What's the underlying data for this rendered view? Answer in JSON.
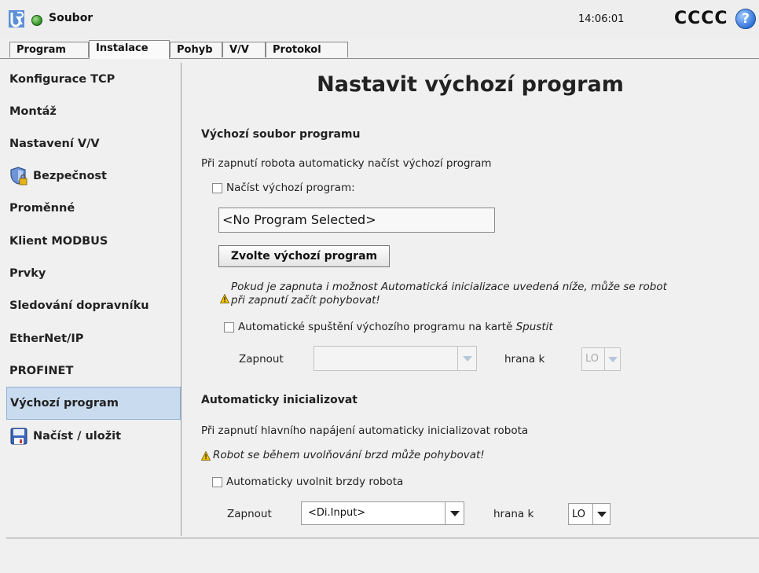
{
  "header": {
    "app_name": "Soubor",
    "clock": "14:06:01",
    "robot_name": "CCCC",
    "help_label": "?"
  },
  "tabs": [
    {
      "label": "Program"
    },
    {
      "label": "Instalace"
    },
    {
      "label": "Pohyb"
    },
    {
      "label": "V/V"
    },
    {
      "label": "Protokol"
    }
  ],
  "sidebar": {
    "items": [
      {
        "label": "Konfigurace TCP"
      },
      {
        "label": "Montáž"
      },
      {
        "label": "Nastavení V/V"
      },
      {
        "label": "Bezpečnost",
        "icon": "safety-shield-lock-icon"
      },
      {
        "label": "Proměnné"
      },
      {
        "label": "Klient MODBUS"
      },
      {
        "label": "Prvky"
      },
      {
        "label": "Sledování dopravníku"
      },
      {
        "label": "EtherNet/IP"
      },
      {
        "label": "PROFINET"
      },
      {
        "label": "Výchozí program",
        "active": true
      },
      {
        "label": "Načíst / uložit",
        "icon": "floppy-disk-icon"
      }
    ]
  },
  "main": {
    "title": "Nastavit výchozí program",
    "default_file": {
      "heading": "Výchozí soubor programu",
      "description": "Při zapnutí robota automaticky načíst výchozí program",
      "load_checkbox_label": "Načíst výchozí program:",
      "program_field_value": "<No Program Selected>",
      "choose_button": "Zvolte výchozí program",
      "warning_line1": "Pokud je zapnuta i možnost Automatická inicializace uvedená níže, může se robot",
      "warning_line2": "při zapnutí začít pohybovat!",
      "autostart_label": "Automatické spuštění výchozího programu na kartě",
      "autostart_tab_name": "Spustit",
      "enable_label": "Zapnout",
      "enable_value": "",
      "edge_label": "hrana k",
      "edge_value": "LO"
    },
    "auto_init": {
      "heading": "Automaticky inicializovat",
      "description": "Při zapnutí hlavního napájení automaticky inicializovat robota",
      "warning": "Robot se během uvolňování brzd může pohybovat!",
      "release_checkbox_label": "Automaticky uvolnit brzdy robota",
      "enable_label": "Zapnout",
      "enable_value": "<Di.Input>",
      "edge_label": "hrana k",
      "edge_value": "LO"
    }
  },
  "colors": {
    "active_sidebar_bg": "#c9dcef",
    "status_green": "#2e8b22",
    "help_blue": "#2d6fd6",
    "warning_yellow": "#f2c200"
  }
}
